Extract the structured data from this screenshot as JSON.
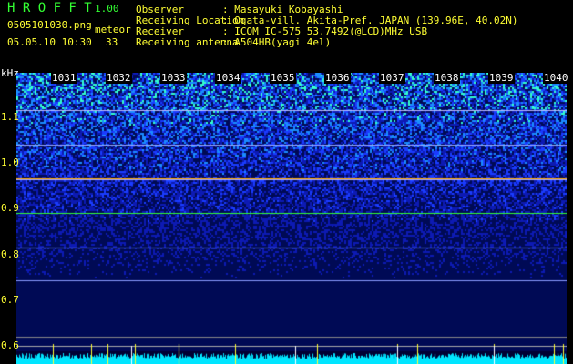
{
  "app": {
    "name": "H R O F F T",
    "version": "1.00"
  },
  "file": {
    "name": "0505101030.png",
    "datetime": "05.05.10 10:30"
  },
  "meteor": {
    "label": "meteor",
    "count": "33"
  },
  "info": [
    {
      "key": "Observer",
      "value": ": Masayuki Kobayashi"
    },
    {
      "key": "Receiving Location",
      "value": ": Ogata-vill. Akita-Pref. JAPAN (139.96E, 40.02N)"
    },
    {
      "key": "Receiver",
      "value": ": ICOM IC-575 53.7492(@LCD)MHz USB"
    },
    {
      "key": "Receiving antenna",
      "value": ": A504HB(yagi 4el)"
    }
  ],
  "axis": {
    "unit": "kHz",
    "x_ticks": [
      "1031",
      "1032",
      "1033",
      "1034",
      "1035",
      "1036",
      "1037",
      "1038",
      "1039",
      "1040"
    ],
    "y_ticks": [
      "1.1",
      "1.0",
      "0.9",
      "0.8",
      "0.7",
      "0.6"
    ]
  },
  "colors": {
    "text": "#ffff33",
    "title": "#33ff33",
    "baseline": "#00e5ff"
  }
}
